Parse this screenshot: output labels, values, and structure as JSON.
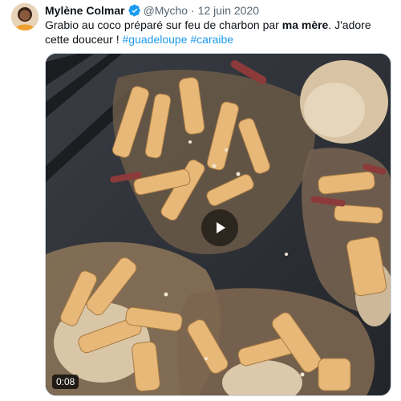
{
  "author": {
    "name": "Mylène Colmar",
    "handle": "@Mycho",
    "separator": "·",
    "date": "12 juin 2020"
  },
  "tweet": {
    "text_part1": "Grabio au coco préparé sur feu de charbon par ",
    "text_bold": "ma mère",
    "text_part2": ". J'adore cette douceur ! ",
    "hashtag1": "#guadeloupe",
    "hashtag2": "#caraibe"
  },
  "video": {
    "duration": "0:08"
  },
  "icons": {
    "verified": "verified-badge-icon",
    "play": "play-icon"
  },
  "colors": {
    "link": "#1d9bf0",
    "verified": "#1d9bf0",
    "secondary_text": "#536471"
  }
}
